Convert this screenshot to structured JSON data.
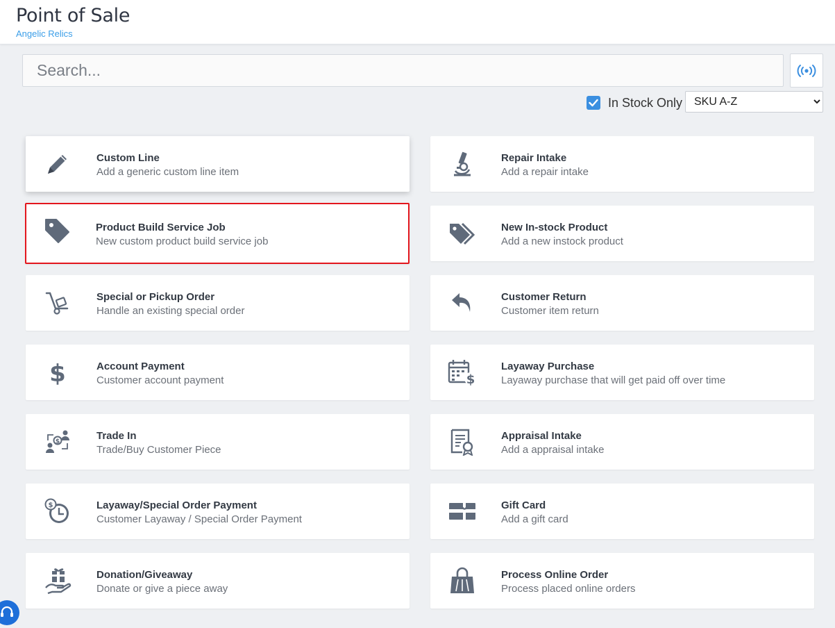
{
  "header": {
    "title": "Point of Sale",
    "store_name": "Angelic Relics"
  },
  "search": {
    "placeholder": "Search...",
    "value": ""
  },
  "filters": {
    "in_stock_only_label": "In Stock Only",
    "in_stock_only_checked": true,
    "sort_selected": "SKU A-Z"
  },
  "colors": {
    "accent": "#3b8fe0",
    "link": "#3b9ee8",
    "icon": "#5f6a7a",
    "selected_border": "#e3161d",
    "background": "#eef0f3"
  },
  "tiles": [
    {
      "title": "Custom Line",
      "subtitle": "Add a generic custom line item",
      "icon": "pencil-icon"
    },
    {
      "title": "Repair Intake",
      "subtitle": "Add a repair intake",
      "icon": "microscope-icon"
    },
    {
      "title": "Product Build Service Job",
      "subtitle": "New custom product build service job",
      "icon": "tag-icon",
      "selected": true
    },
    {
      "title": "New In-stock Product",
      "subtitle": "Add a new instock product",
      "icon": "tags-icon"
    },
    {
      "title": "Special or Pickup Order",
      "subtitle": "Handle an existing special order",
      "icon": "hand-truck-icon"
    },
    {
      "title": "Customer Return",
      "subtitle": "Customer item return",
      "icon": "reply-arrow-icon"
    },
    {
      "title": "Account Payment",
      "subtitle": "Customer account payment",
      "icon": "dollar-icon"
    },
    {
      "title": "Layaway Purchase",
      "subtitle": "Layaway purchase that will get paid off over time",
      "icon": "calendar-dollar-icon"
    },
    {
      "title": "Trade In",
      "subtitle": "Trade/Buy Customer Piece",
      "icon": "trade-exchange-icon"
    },
    {
      "title": "Appraisal Intake",
      "subtitle": "Add a appraisal intake",
      "icon": "certificate-icon"
    },
    {
      "title": "Layaway/Special Order Payment",
      "subtitle": "Customer Layaway / Special Order Payment",
      "icon": "clock-dollar-icon"
    },
    {
      "title": "Gift Card",
      "subtitle": "Add a gift card",
      "icon": "gift-card-icon"
    },
    {
      "title": "Donation/Giveaway",
      "subtitle": "Donate or give a piece away",
      "icon": "hand-gift-icon"
    },
    {
      "title": "Process Online Order",
      "subtitle": "Process placed online orders",
      "icon": "shopping-bag-icon"
    }
  ],
  "help_widget": {
    "icon": "help-headset-icon"
  }
}
